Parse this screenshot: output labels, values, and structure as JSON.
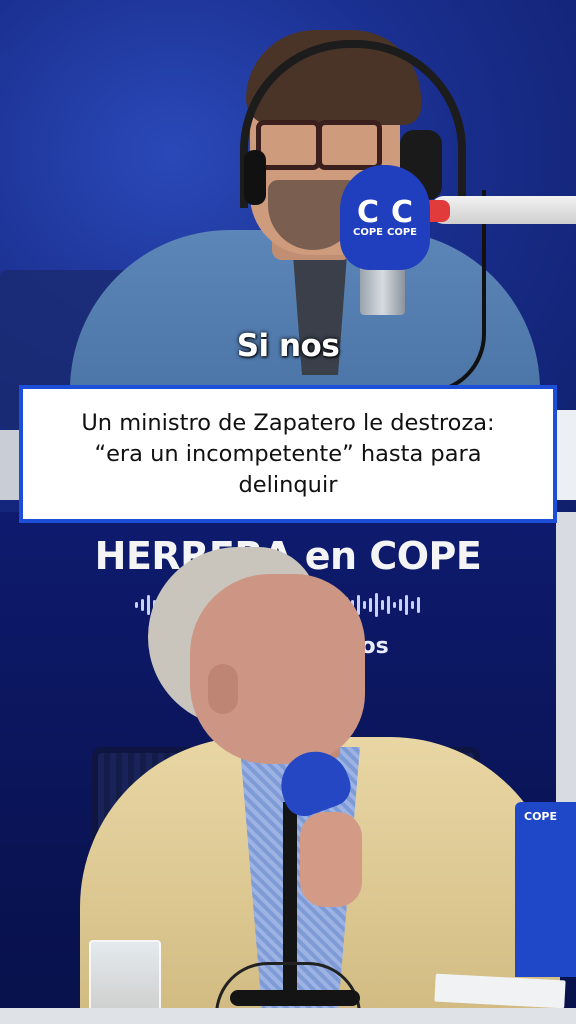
{
  "caption": {
    "text": "Si nos"
  },
  "headline": {
    "line1": "Un ministro de Zapatero le destroza:",
    "line2": "“era un incompetente” hasta para",
    "line3": "delinquir"
  },
  "studio": {
    "brand_title": "HERRERA en COPE",
    "brand_sub_fragment": "tos",
    "mic_logo_text": "COPE",
    "laptop_logo_text": "COPE"
  },
  "colors": {
    "headline_border": "#1c4ed8",
    "cope_blue": "#1f3fbf",
    "background": "#0b1a5c"
  }
}
